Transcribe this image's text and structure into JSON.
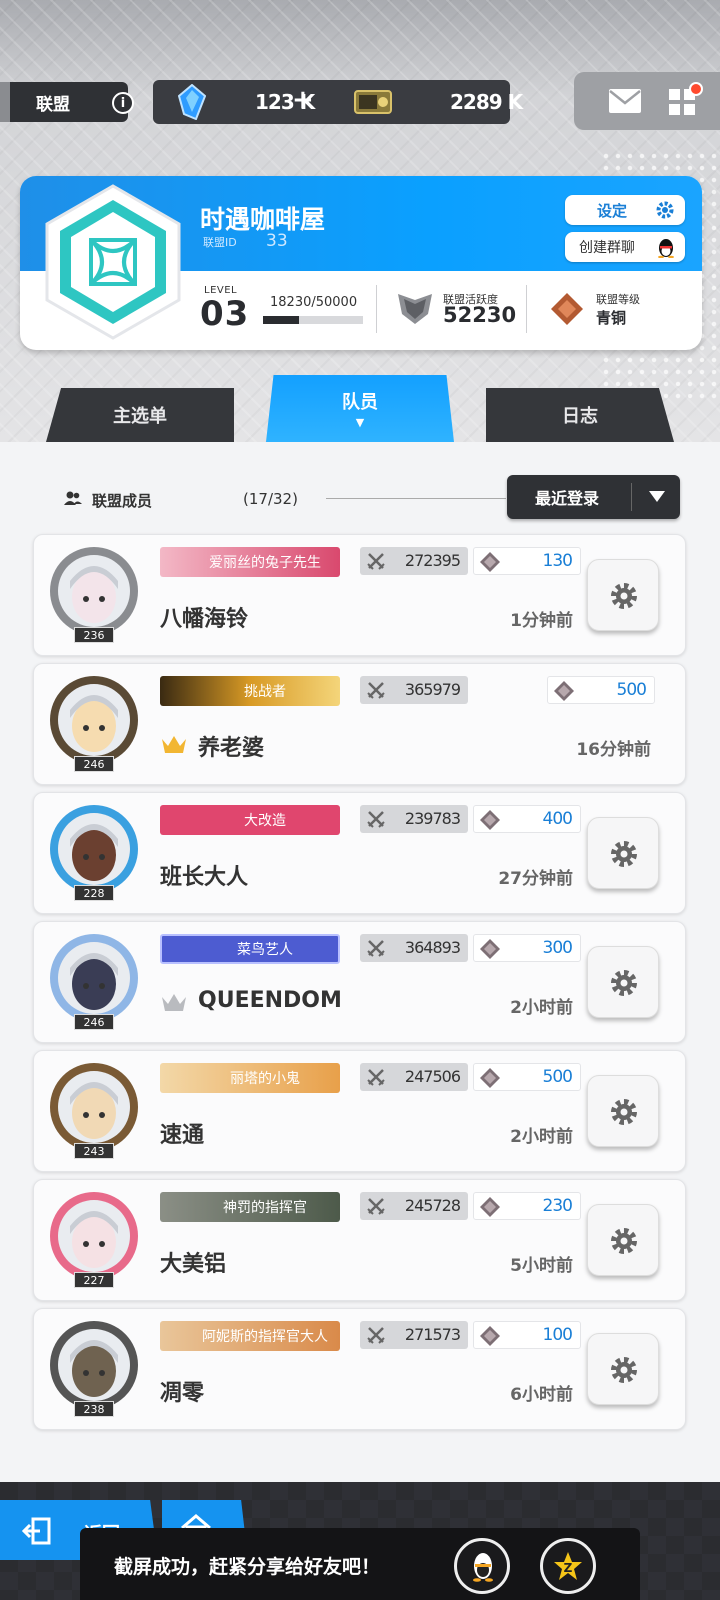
{
  "header": {
    "alliance_label": "联盟",
    "info_icon": "info-icon",
    "gems_value": "123 K",
    "gems_plus": "+",
    "credits_value": "2289 K"
  },
  "alliance": {
    "name": "时遇咖啡屋",
    "id_label": "联盟ID",
    "id_value": "33",
    "settings_label": "设定",
    "group_chat_label": "创建群聊",
    "level_label": "LEVEL",
    "level_value": "03",
    "exp_text": "18230/50000",
    "exp_fraction": 0.3646,
    "activity_label": "联盟活跃度",
    "activity_value": "52230",
    "rank_label": "联盟等级",
    "rank_value": "青铜"
  },
  "tabs": [
    {
      "label": "主选单",
      "active": false
    },
    {
      "label": "队员",
      "active": true
    },
    {
      "label": "日志",
      "active": false
    }
  ],
  "members_header": {
    "label": "联盟成员",
    "count": "(17/32)",
    "sort_label": "最近登录"
  },
  "members": [
    {
      "level": "236",
      "title": "爱丽丝的兔子先生",
      "power": "272395",
      "contrib": "130",
      "name": "八幡海铃",
      "time": "1分钟前",
      "crown": "",
      "has_gear": true
    },
    {
      "level": "246",
      "title": "挑战者",
      "power": "365979",
      "contrib": "500",
      "name": "养老婆",
      "time": "16分钟前",
      "crown": "gold",
      "has_gear": false
    },
    {
      "level": "228",
      "title": "大改造",
      "power": "239783",
      "contrib": "400",
      "name": "班长大人",
      "time": "27分钟前",
      "crown": "",
      "has_gear": true
    },
    {
      "level": "246",
      "title": "菜鸟艺人",
      "power": "364893",
      "contrib": "300",
      "name": "QUEENDOM",
      "time": "2小时前",
      "crown": "silver",
      "has_gear": true
    },
    {
      "level": "243",
      "title": "丽塔的小鬼",
      "power": "247506",
      "contrib": "500",
      "name": "速通",
      "time": "2小时前",
      "crown": "",
      "has_gear": true
    },
    {
      "level": "227",
      "title": "神罚的指挥官",
      "power": "245728",
      "contrib": "230",
      "name": "大美铝",
      "time": "5小时前",
      "crown": "",
      "has_gear": true
    },
    {
      "level": "238",
      "title": "阿妮斯的指挥官大人",
      "power": "271573",
      "contrib": "100",
      "name": "凋零",
      "time": "6小时前",
      "crown": "",
      "has_gear": true
    }
  ],
  "footer": {
    "back_label": "返回",
    "toast_text": "截屏成功，赶紧分享给好友吧！"
  },
  "colors": {
    "accent_blue": "#0aa0ff",
    "dark_panel": "#2f3135",
    "contrib_text": "#1a7fd6"
  }
}
